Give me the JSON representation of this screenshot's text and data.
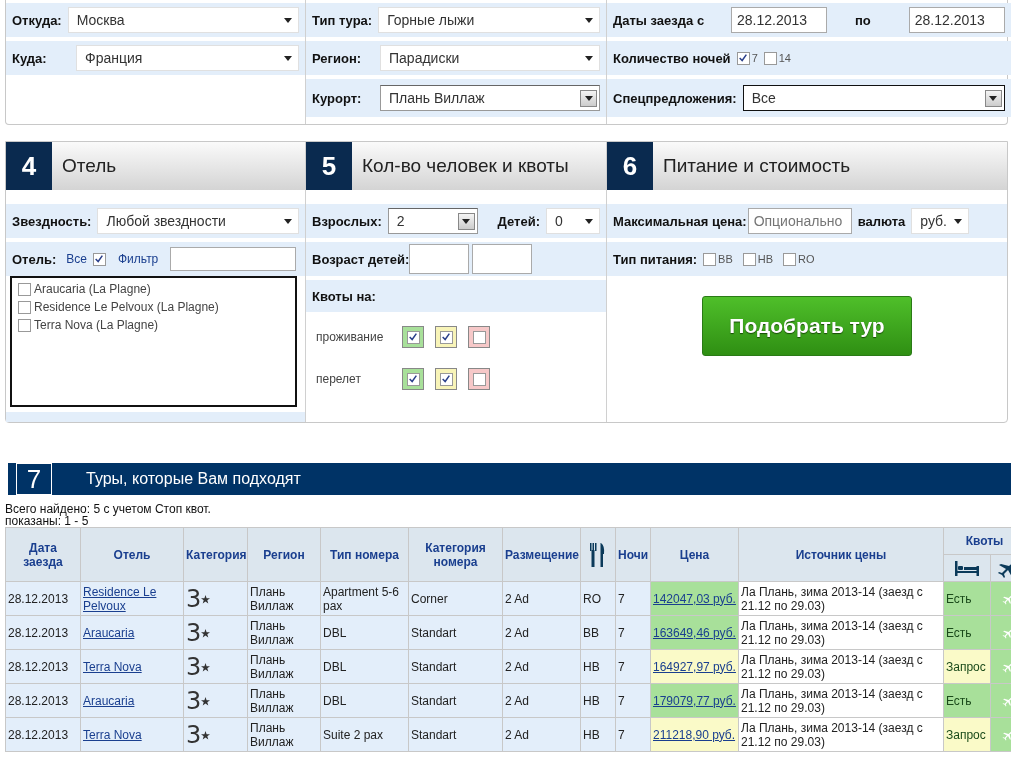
{
  "search": {
    "from": {
      "label": "Откуда:",
      "value": "Москва"
    },
    "to": {
      "label": "Куда:",
      "value": "Франция"
    },
    "tour_type": {
      "label": "Тип тура:",
      "value": "Горные лыжи"
    },
    "region": {
      "label": "Регион:",
      "value": "Парадиски"
    },
    "resort": {
      "label": "Курорт:",
      "value": "Плань Виллаж"
    },
    "dates": {
      "label": "Даты заезда с",
      "from": "28.12.2013",
      "to_label": "по",
      "to": "28.12.2013"
    },
    "nights": {
      "label": "Количество ночей",
      "options": [
        {
          "label": "7",
          "checked": true
        },
        {
          "label": "14",
          "checked": false
        }
      ]
    },
    "special": {
      "label": "Спецпредложения:",
      "value": "Все"
    }
  },
  "hotel": {
    "number": "4",
    "title": "Отель",
    "stars": {
      "label": "Звездность:",
      "value": "Любой звездности"
    },
    "hotel_label": "Отель:",
    "all_label": "Все",
    "all_checked": true,
    "filter_label": "Фильтр",
    "hotels": [
      {
        "name": "Araucaria (La Plagne)",
        "checked": false
      },
      {
        "name": "Residence Le Pelvoux (La Plagne)",
        "checked": false
      },
      {
        "name": "Terra Nova (La Plagne)",
        "checked": false
      }
    ]
  },
  "people": {
    "number": "5",
    "title": "Кол-во человек и квоты",
    "adults_label": "Взрослых:",
    "adults": "2",
    "children_label": "Детей:",
    "children": "0",
    "ages_label": "Возраст детей:",
    "quotas_label": "Квоты на:",
    "quota_rows": [
      {
        "label": "проживание",
        "boxes": [
          {
            "checked": true,
            "color": "#a8e09a"
          },
          {
            "checked": true,
            "color": "#f8f4b8"
          },
          {
            "checked": false,
            "color": "#f6c8c8"
          }
        ]
      },
      {
        "label": "перелет",
        "boxes": [
          {
            "checked": true,
            "color": "#a8e09a"
          },
          {
            "checked": true,
            "color": "#f8f4b8"
          },
          {
            "checked": false,
            "color": "#f6c8c8"
          }
        ]
      }
    ]
  },
  "food": {
    "number": "6",
    "title": "Питание и стоимость",
    "max_price_label": "Максимальная цена:",
    "max_price_placeholder": "Опционально",
    "currency_label": "валюта",
    "currency": "руб.",
    "meal_label": "Тип питания:",
    "meals": [
      {
        "label": "BB",
        "checked": false
      },
      {
        "label": "HB",
        "checked": false
      },
      {
        "label": "RO",
        "checked": false
      }
    ],
    "button": "Подобрать тур"
  },
  "results": {
    "number": "7",
    "title": "Туры, которые Вам подходят",
    "found": "Всего найдено: 5 с учетом Стоп квот.",
    "shown": "показаны: 1 - 5",
    "columns": [
      "Дата заезда",
      "Отель",
      "Категория",
      "Регион",
      "Тип номера",
      "Категория номера",
      "Размещение",
      "",
      "Ночи",
      "Цена",
      "Источник цены"
    ],
    "quota_header": "Квоты",
    "rows": [
      {
        "date": "28.12.2013",
        "hotel": "Residence Le Pelvoux",
        "category": "3",
        "region": "Плань Виллаж",
        "room_type": "Apartment 5-6 pax",
        "room_category": "Corner",
        "accommodation": "2 Ad",
        "meal": "RO",
        "nights": "7",
        "price": "142047,03 руб.",
        "color": "#a8e09a",
        "source": "Ла Плань, зима 2013-14 (заезд с 21.12 по 29.03)",
        "quota": "Есть"
      },
      {
        "date": "28.12.2013",
        "hotel": "Araucaria",
        "category": "3",
        "region": "Плань Виллаж",
        "room_type": "DBL",
        "room_category": "Standart",
        "accommodation": "2 Ad",
        "meal": "BB",
        "nights": "7",
        "price": "163649,46 руб.",
        "color": "#a8e09a",
        "source": "Ла Плань, зима 2013-14 (заезд с 21.12 по 29.03)",
        "quota": "Есть"
      },
      {
        "date": "28.12.2013",
        "hotel": "Terra Nova",
        "category": "3",
        "region": "Плань Виллаж",
        "room_type": "DBL",
        "room_category": "Standart",
        "accommodation": "2 Ad",
        "meal": "HB",
        "nights": "7",
        "price": "164927,97 руб.",
        "color": "#fafac8",
        "source": "Ла Плань, зима 2013-14 (заезд с 21.12 по 29.03)",
        "quota": "Запрос"
      },
      {
        "date": "28.12.2013",
        "hotel": "Araucaria",
        "category": "3",
        "region": "Плань Виллаж",
        "room_type": "DBL",
        "room_category": "Standart",
        "accommodation": "2 Ad",
        "meal": "HB",
        "nights": "7",
        "price": "179079,77 руб.",
        "color": "#a8e09a",
        "source": "Ла Плань, зима 2013-14 (заезд с 21.12 по 29.03)",
        "quota": "Есть"
      },
      {
        "date": "28.12.2013",
        "hotel": "Terra Nova",
        "category": "3",
        "region": "Плань Виллаж",
        "room_type": "Suite 2 pax",
        "room_category": "Standart",
        "accommodation": "2 Ad",
        "meal": "HB",
        "nights": "7",
        "price": "211218,90 руб.",
        "color": "#fafac8",
        "source": "Ла Плань, зима 2013-14 (заезд с 21.12 по 29.03)",
        "quota": "Запрос"
      }
    ]
  }
}
